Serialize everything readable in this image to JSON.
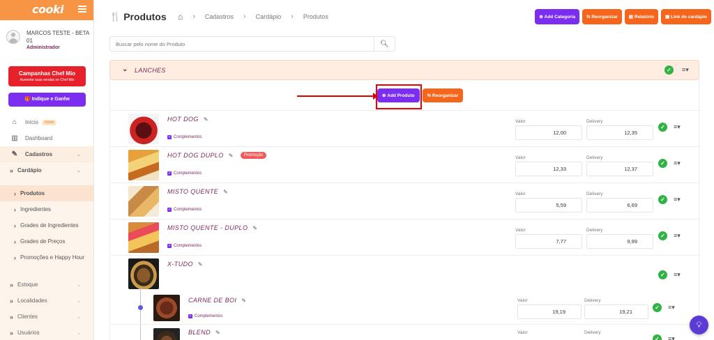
{
  "app": {
    "logo": "cooki"
  },
  "user": {
    "name": "MARCOS TESTE - BETA 01",
    "role": "Administrador"
  },
  "campaign": {
    "title": "Campanhas Chef Mio",
    "subtitle": "Aumente suas vendas no Chef Mio"
  },
  "indique": {
    "label": "Indique e Ganhe"
  },
  "menu": {
    "inicio": "Início",
    "novo": "novo",
    "dashboard": "Dashboard",
    "cadastros": "Cadastros",
    "cardapio": "Cardápio",
    "produtos": "Produtos",
    "ingredientes": "Ingredientes",
    "grades_ingredientes": "Grades de Ingredientes",
    "grades_precos": "Grades de Preços",
    "promocoes": "Promoções e Happy Hour",
    "estoque": "Estoque",
    "localidades": "Localidades",
    "clientes": "Clientes",
    "usuarios": "Usuários"
  },
  "header": {
    "title": "Produtos",
    "crumbs": [
      "Cadastros",
      "Cardápio",
      "Produtos"
    ]
  },
  "toolbar": {
    "add_categoria": "Add Categoria",
    "reorganizar": "Reorganizar",
    "relatorio": "Relatório",
    "link_cardapio": "Link do cardápio"
  },
  "search": {
    "placeholder": "Buscar pelo nome do Produto"
  },
  "category": {
    "name": "LANCHES",
    "add_produto": "Add Produto",
    "reorganizar": "Reorganizar"
  },
  "labels": {
    "valor": "Valor",
    "delivery": "Delivery",
    "complementos": "Complementos"
  },
  "products": [
    {
      "name": "HOT DOG",
      "valor": "12,00",
      "delivery": "12,35",
      "promo": ""
    },
    {
      "name": "HOT DOG DUPLO",
      "valor": "12,33",
      "delivery": "12,37",
      "promo": "Promoção"
    },
    {
      "name": "MISTO QUENTE",
      "valor": "5,59",
      "delivery": "6,69",
      "promo": ""
    },
    {
      "name": "MISTO QUENTE - DUPLO",
      "valor": "7,77",
      "delivery": "9,99",
      "promo": ""
    },
    {
      "name": "X-TUDO"
    }
  ],
  "sub_products": [
    {
      "name": "CARNE DE BOI",
      "valor": "19,19",
      "delivery": "19,21"
    },
    {
      "name": "BLEND"
    }
  ],
  "colors": {
    "primary": "#7c2ef0",
    "accent": "#f6651c",
    "brand_bar": "#f79545",
    "campaign": "#e6212b",
    "ok": "#2fb344"
  }
}
